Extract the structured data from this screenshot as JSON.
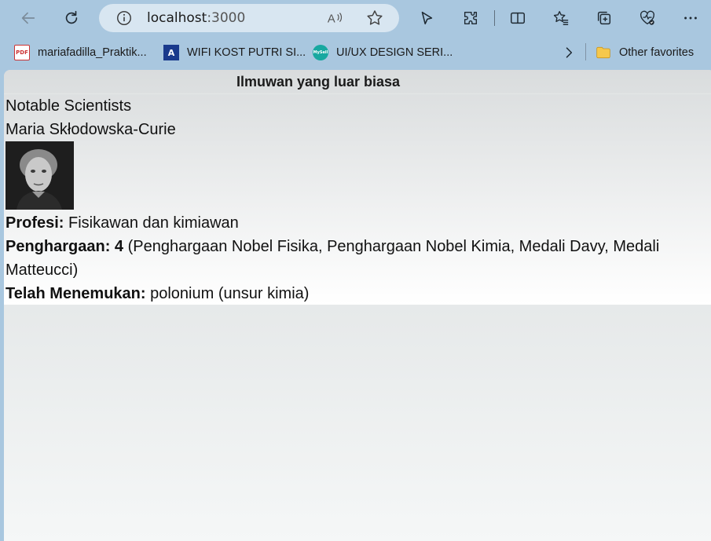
{
  "browser": {
    "url_host": "localhost",
    "url_port": ":3000",
    "read_aloud_label": "A))",
    "icons": {
      "back": "back-arrow-icon",
      "refresh": "refresh-icon",
      "info": "info-icon",
      "star": "favorite-star-icon",
      "cursor": "cursor-icon",
      "extensions": "extensions-icon",
      "split": "split-screen-icon",
      "favorites": "favorites-icon",
      "collections": "collections-icon",
      "health": "browser-essentials-icon",
      "menu": "more-menu-icon"
    }
  },
  "favorites": {
    "items": [
      {
        "label": "mariafadilla_Praktik...",
        "icon": "pdf-icon"
      },
      {
        "label": "WIFI KOST PUTRI SI...",
        "icon": "a-logo-icon"
      },
      {
        "label": "UI/UX DESIGN SERI...",
        "icon": "mysell-icon"
      }
    ],
    "other_label": "Other favorites",
    "chevron": "chevron-right-icon",
    "a_logo_text": "A",
    "pdf_text": "PDF",
    "mysell_text": "MySell"
  },
  "app": {
    "title": "Ilmuwan yang luar biasa",
    "heading": "Notable Scientists",
    "scientist_name": "Maria Skłodowska-Curie",
    "profession_label": "Profesi:",
    "profession_value": " Fisikawan dan kimiawan",
    "awards_label": "Penghargaan: 4",
    "awards_value": " (Penghargaan Nobel Fisika, Penghargaan Nobel Kimia, Medali Davy, Medali Matteucci)",
    "discovery_label": "Telah Menemukan:",
    "discovery_value": " polonium (unsur kimia)"
  }
}
